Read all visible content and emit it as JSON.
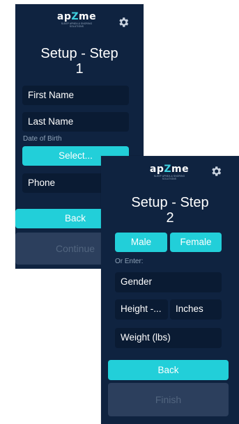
{
  "colors": {
    "background": "#0f2340",
    "field": "#0a1b33",
    "accent": "#22cfd9",
    "disabled": "#2c3f5d"
  },
  "brand": {
    "name_prefix": "ap",
    "name_z": "Z",
    "name_suffix": "me",
    "tagline": "SLEEP APNEA & SNORING SOLUTIONS"
  },
  "icons": {
    "settings": "gear-icon"
  },
  "step1": {
    "title_line1": "Setup - Step",
    "title_line2": "1",
    "first_name_placeholder": "First Name",
    "last_name_placeholder": "Last Name",
    "dob_label": "Date of Birth",
    "dob_button": "Select...",
    "phone_placeholder": "Phone",
    "back_label": "Back",
    "continue_label": "Continue"
  },
  "step2": {
    "title_line1": "Setup - Step",
    "title_line2": "2",
    "male_label": "Male",
    "female_label": "Female",
    "or_enter_label": "Or Enter:",
    "gender_placeholder": "Gender",
    "height_feet_placeholder": "Height -...",
    "height_inches_placeholder": "Inches",
    "weight_placeholder": "Weight (lbs)",
    "back_label": "Back",
    "finish_label": "Finish"
  }
}
